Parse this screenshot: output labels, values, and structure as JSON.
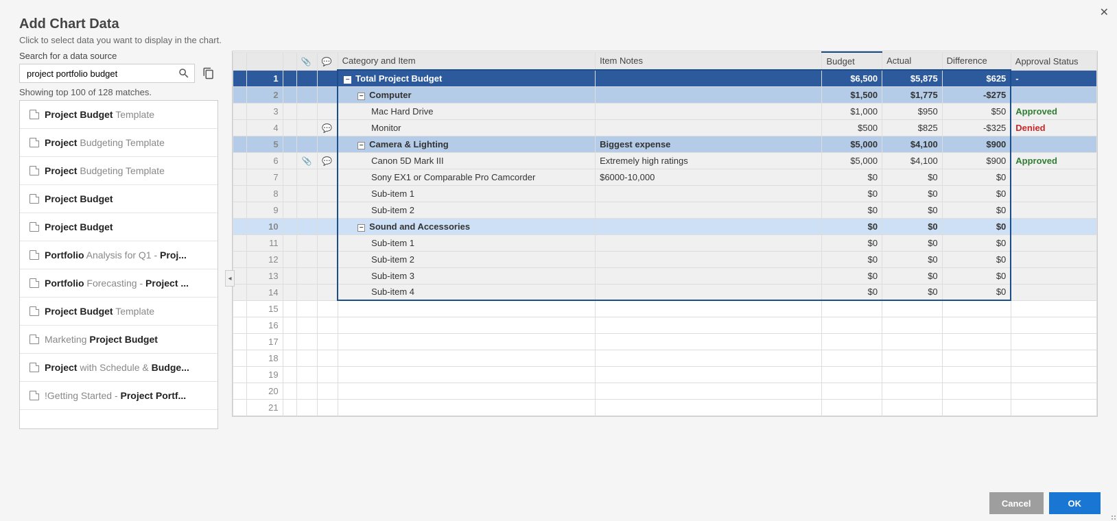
{
  "header": {
    "title": "Add Chart Data",
    "subtitle": "Click to select data you want to display in the chart."
  },
  "search": {
    "label": "Search for a data source",
    "value": "project portfolio budget",
    "result_count": "Showing top 100 of 128 matches.",
    "results": [
      {
        "markup": [
          [
            "Project Budget",
            true
          ],
          [
            " Template",
            false
          ]
        ]
      },
      {
        "markup": [
          [
            "Project",
            true
          ],
          [
            " Budgeting Template",
            false
          ]
        ]
      },
      {
        "markup": [
          [
            "Project",
            true
          ],
          [
            " Budgeting Template",
            false
          ]
        ]
      },
      {
        "markup": [
          [
            "Project Budget",
            true
          ]
        ]
      },
      {
        "markup": [
          [
            "Project Budget",
            true
          ]
        ]
      },
      {
        "markup": [
          [
            "Portfolio",
            true
          ],
          [
            " Analysis for Q1 - ",
            false
          ],
          [
            "Proj...",
            true
          ]
        ]
      },
      {
        "markup": [
          [
            "Portfolio",
            true
          ],
          [
            " Forecasting - ",
            false
          ],
          [
            "Project ...",
            true
          ]
        ]
      },
      {
        "markup": [
          [
            "Project Budget",
            true
          ],
          [
            " Template",
            false
          ]
        ]
      },
      {
        "markup": [
          [
            "Marketing ",
            false
          ],
          [
            "Project Budget",
            true
          ]
        ]
      },
      {
        "markup": [
          [
            "Project",
            true
          ],
          [
            " with Schedule & ",
            false
          ],
          [
            "Budge...",
            true
          ]
        ]
      },
      {
        "markup": [
          [
            "!Getting Started - ",
            false
          ],
          [
            "Project Portf...",
            true
          ]
        ]
      }
    ]
  },
  "grid": {
    "columns": {
      "category": "Category and Item",
      "notes": "Item Notes",
      "budget": "Budget",
      "actual": "Actual",
      "difference": "Difference",
      "approval": "Approval Status"
    },
    "rows": [
      {
        "n": 1,
        "kind": "total",
        "indent": 0,
        "toggle": "-",
        "category": "Total Project Budget",
        "notes": "",
        "budget": "$6,500",
        "actual": "$5,875",
        "difference": "$625",
        "approval": "-"
      },
      {
        "n": 2,
        "kind": "subtotal",
        "indent": 1,
        "toggle": "-",
        "category": "Computer",
        "notes": "",
        "budget": "$1,500",
        "actual": "$1,775",
        "difference": "-$275",
        "approval": ""
      },
      {
        "n": 3,
        "kind": "item",
        "indent": 2,
        "category": "Mac Hard Drive",
        "notes": "",
        "budget": "$1,000",
        "actual": "$950",
        "difference": "$50",
        "approval": "Approved"
      },
      {
        "n": 4,
        "kind": "item",
        "indent": 2,
        "category": "Monitor",
        "notes": "",
        "budget": "$500",
        "actual": "$825",
        "difference": "-$325",
        "approval": "Denied",
        "comment": true
      },
      {
        "n": 5,
        "kind": "subtotal",
        "indent": 1,
        "toggle": "-",
        "category": "Camera & Lighting",
        "notes": "Biggest expense",
        "budget": "$5,000",
        "actual": "$4,100",
        "difference": "$900",
        "approval": ""
      },
      {
        "n": 6,
        "kind": "item",
        "indent": 2,
        "category": "Canon 5D Mark III",
        "notes": "Extremely high ratings",
        "budget": "$5,000",
        "actual": "$4,100",
        "difference": "$900",
        "approval": "Approved",
        "attach": true,
        "comment": true
      },
      {
        "n": 7,
        "kind": "item",
        "indent": 2,
        "category": "Sony EX1 or Comparable Pro Camcorder",
        "notes": "$6000-10,000",
        "budget": "$0",
        "actual": "$0",
        "difference": "$0",
        "approval": ""
      },
      {
        "n": 8,
        "kind": "item",
        "indent": 2,
        "category": "Sub-item 1",
        "notes": "",
        "budget": "$0",
        "actual": "$0",
        "difference": "$0",
        "approval": ""
      },
      {
        "n": 9,
        "kind": "item",
        "indent": 2,
        "category": "Sub-item 2",
        "notes": "",
        "budget": "$0",
        "actual": "$0",
        "difference": "$0",
        "approval": ""
      },
      {
        "n": 10,
        "kind": "subtotal-light",
        "indent": 1,
        "toggle": "-",
        "category": "Sound and Accessories",
        "notes": "",
        "budget": "$0",
        "actual": "$0",
        "difference": "$0",
        "approval": ""
      },
      {
        "n": 11,
        "kind": "item",
        "indent": 2,
        "category": "Sub-item 1",
        "notes": "",
        "budget": "$0",
        "actual": "$0",
        "difference": "$0",
        "approval": ""
      },
      {
        "n": 12,
        "kind": "item",
        "indent": 2,
        "category": "Sub-item 2",
        "notes": "",
        "budget": "$0",
        "actual": "$0",
        "difference": "$0",
        "approval": ""
      },
      {
        "n": 13,
        "kind": "item",
        "indent": 2,
        "category": "Sub-item 3",
        "notes": "",
        "budget": "$0",
        "actual": "$0",
        "difference": "$0",
        "approval": ""
      },
      {
        "n": 14,
        "kind": "item",
        "indent": 2,
        "category": "Sub-item 4",
        "notes": "",
        "budget": "$0",
        "actual": "$0",
        "difference": "$0",
        "approval": ""
      },
      {
        "n": 15,
        "kind": "blank"
      },
      {
        "n": 16,
        "kind": "blank"
      },
      {
        "n": 17,
        "kind": "blank"
      },
      {
        "n": 18,
        "kind": "blank"
      },
      {
        "n": 19,
        "kind": "blank"
      },
      {
        "n": 20,
        "kind": "blank"
      },
      {
        "n": 21,
        "kind": "blank"
      }
    ]
  },
  "footer": {
    "cancel": "Cancel",
    "ok": "OK"
  },
  "chart_data": {
    "type": "table",
    "title": "Total Project Budget",
    "columns": [
      "Category and Item",
      "Item Notes",
      "Budget",
      "Actual",
      "Difference",
      "Approval Status"
    ],
    "rows": [
      [
        "Total Project Budget",
        "",
        6500,
        5875,
        625,
        "-"
      ],
      [
        "Computer",
        "",
        1500,
        1775,
        -275,
        ""
      ],
      [
        "Mac Hard Drive",
        "",
        1000,
        950,
        50,
        "Approved"
      ],
      [
        "Monitor",
        "",
        500,
        825,
        -325,
        "Denied"
      ],
      [
        "Camera & Lighting",
        "Biggest expense",
        5000,
        4100,
        900,
        ""
      ],
      [
        "Canon 5D Mark III",
        "Extremely high ratings",
        5000,
        4100,
        900,
        "Approved"
      ],
      [
        "Sony EX1 or Comparable Pro Camcorder",
        "$6000-10,000",
        0,
        0,
        0,
        ""
      ],
      [
        "Sub-item 1",
        "",
        0,
        0,
        0,
        ""
      ],
      [
        "Sub-item 2",
        "",
        0,
        0,
        0,
        ""
      ],
      [
        "Sound and Accessories",
        "",
        0,
        0,
        0,
        ""
      ],
      [
        "Sub-item 1",
        "",
        0,
        0,
        0,
        ""
      ],
      [
        "Sub-item 2",
        "",
        0,
        0,
        0,
        ""
      ],
      [
        "Sub-item 3",
        "",
        0,
        0,
        0,
        ""
      ],
      [
        "Sub-item 4",
        "",
        0,
        0,
        0,
        ""
      ]
    ]
  }
}
